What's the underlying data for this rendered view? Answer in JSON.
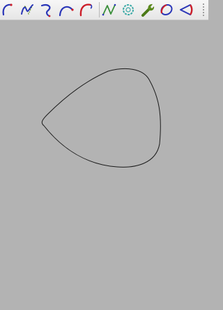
{
  "toolbar": {
    "tools": [
      {
        "icon": "arc-icon"
      },
      {
        "icon": "bspline-icon"
      },
      {
        "icon": "curve-hook-icon"
      },
      {
        "icon": "arc-with-control-point-icon"
      },
      {
        "icon": "partial-circle-icon"
      },
      {
        "icon": "polyline-icon"
      },
      {
        "icon": "cog-profile-icon"
      },
      {
        "icon": "wrench-icon"
      },
      {
        "icon": "ellipse-icon"
      },
      {
        "icon": "closed-profile-icon"
      }
    ]
  },
  "colors": {
    "canvas_background": "#b3b3b3",
    "curve_stroke": "#1a1a1a",
    "icon_red": "#cc1f2a",
    "icon_blue": "#2a36b8",
    "icon_green": "#5c8a1e",
    "icon_teal": "#3aa9a6"
  }
}
